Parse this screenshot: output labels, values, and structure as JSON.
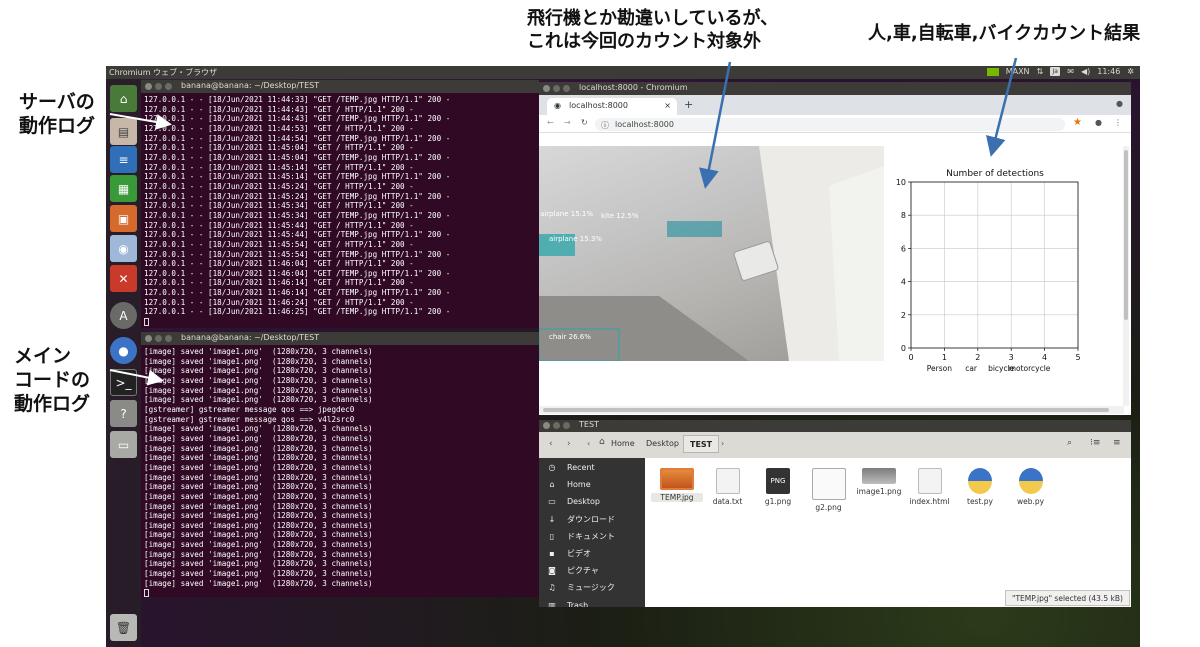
{
  "annotations": {
    "airplane_note_l1": "飛行機とか勘違いしているが、",
    "airplane_note_l2": "これは今回のカウント対象外",
    "count_note": "人,車,自転車,バイクカウント結果",
    "server_note_l1": "サーバの",
    "server_note_l2": "動作ログ",
    "main_note_l1": "メイン",
    "main_note_l2": "コードの",
    "main_note_l3": "動作ログ"
  },
  "topbar": {
    "title": "Chromium ウェブ・ブラウザ",
    "network": "MAXN",
    "keyboard": "Ja",
    "time": "11:46"
  },
  "terminal_top": {
    "title": "banana@banana: ~/Desktop/TEST",
    "lines": [
      "127.0.0.1 - - [18/Jun/2021 11:44:33] \"GET /TEMP.jpg HTTP/1.1\" 200 -",
      "127.0.0.1 - - [18/Jun/2021 11:44:43] \"GET / HTTP/1.1\" 200 -",
      "127.0.0.1 - - [18/Jun/2021 11:44:43] \"GET /TEMP.jpg HTTP/1.1\" 200 -",
      "127.0.0.1 - - [18/Jun/2021 11:44:53] \"GET / HTTP/1.1\" 200 -",
      "127.0.0.1 - - [18/Jun/2021 11:44:54] \"GET /TEMP.jpg HTTP/1.1\" 200 -",
      "127.0.0.1 - - [18/Jun/2021 11:45:04] \"GET / HTTP/1.1\" 200 -",
      "127.0.0.1 - - [18/Jun/2021 11:45:04] \"GET /TEMP.jpg HTTP/1.1\" 200 -",
      "127.0.0.1 - - [18/Jun/2021 11:45:14] \"GET / HTTP/1.1\" 200 -",
      "127.0.0.1 - - [18/Jun/2021 11:45:14] \"GET /TEMP.jpg HTTP/1.1\" 200 -",
      "127.0.0.1 - - [18/Jun/2021 11:45:24] \"GET / HTTP/1.1\" 200 -",
      "127.0.0.1 - - [18/Jun/2021 11:45:24] \"GET /TEMP.jpg HTTP/1.1\" 200 -",
      "127.0.0.1 - - [18/Jun/2021 11:45:34] \"GET / HTTP/1.1\" 200 -",
      "127.0.0.1 - - [18/Jun/2021 11:45:34] \"GET /TEMP.jpg HTTP/1.1\" 200 -",
      "127.0.0.1 - - [18/Jun/2021 11:45:44] \"GET / HTTP/1.1\" 200 -",
      "127.0.0.1 - - [18/Jun/2021 11:45:44] \"GET /TEMP.jpg HTTP/1.1\" 200 -",
      "127.0.0.1 - - [18/Jun/2021 11:45:54] \"GET / HTTP/1.1\" 200 -",
      "127.0.0.1 - - [18/Jun/2021 11:45:54] \"GET /TEMP.jpg HTTP/1.1\" 200 -",
      "127.0.0.1 - - [18/Jun/2021 11:46:04] \"GET / HTTP/1.1\" 200 -",
      "127.0.0.1 - - [18/Jun/2021 11:46:04] \"GET /TEMP.jpg HTTP/1.1\" 200 -",
      "127.0.0.1 - - [18/Jun/2021 11:46:14] \"GET / HTTP/1.1\" 200 -",
      "127.0.0.1 - - [18/Jun/2021 11:46:14] \"GET /TEMP.jpg HTTP/1.1\" 200 -",
      "127.0.0.1 - - [18/Jun/2021 11:46:24] \"GET / HTTP/1.1\" 200 -",
      "127.0.0.1 - - [18/Jun/2021 11:46:25] \"GET /TEMP.jpg HTTP/1.1\" 200 -"
    ]
  },
  "terminal_bottom": {
    "title": "banana@banana: ~/Desktop/TEST",
    "lines": [
      "[image] saved 'image1.png'  (1280x720, 3 channels)",
      "[image] saved 'image1.png'  (1280x720, 3 channels)",
      "[image] saved 'image1.png'  (1280x720, 3 channels)",
      "[image] saved 'image1.png'  (1280x720, 3 channels)",
      "[image] saved 'image1.png'  (1280x720, 3 channels)",
      "[image] saved 'image1.png'  (1280x720, 3 channels)",
      "[gstreamer] gstreamer message qos ==> jpegdec0",
      "[gstreamer] gstreamer message qos ==> v4l2src0",
      "[image] saved 'image1.png'  (1280x720, 3 channels)",
      "[image] saved 'image1.png'  (1280x720, 3 channels)",
      "[image] saved 'image1.png'  (1280x720, 3 channels)",
      "[image] saved 'image1.png'  (1280x720, 3 channels)",
      "[image] saved 'image1.png'  (1280x720, 3 channels)",
      "[image] saved 'image1.png'  (1280x720, 3 channels)",
      "[image] saved 'image1.png'  (1280x720, 3 channels)",
      "[image] saved 'image1.png'  (1280x720, 3 channels)",
      "[image] saved 'image1.png'  (1280x720, 3 channels)",
      "[image] saved 'image1.png'  (1280x720, 3 channels)",
      "[image] saved 'image1.png'  (1280x720, 3 channels)",
      "[image] saved 'image1.png'  (1280x720, 3 channels)",
      "[image] saved 'image1.png'  (1280x720, 3 channels)",
      "[image] saved 'image1.png'  (1280x720, 3 channels)",
      "[image] saved 'image1.png'  (1280x720, 3 channels)",
      "[image] saved 'image1.png'  (1280x720, 3 channels)",
      "[image] saved 'image1.png'  (1280x720, 3 channels)"
    ]
  },
  "browser": {
    "window_title": "localhost:8000 - Chromium",
    "tab_label": "localhost:8000",
    "url": "localhost:8000",
    "detections": [
      {
        "label": "airplane 15.1%"
      },
      {
        "label": "kite 12.5%"
      },
      {
        "label": "airplane 15.3%"
      },
      {
        "label": "chair 26.6%"
      }
    ]
  },
  "chart_data": {
    "type": "bar",
    "title": "Number of detections",
    "categories": [
      "Person",
      "car",
      "bicycle",
      "motorcycle"
    ],
    "values": [
      0,
      0,
      0,
      0
    ],
    "x_ticks": [
      "0",
      "1",
      "2",
      "3",
      "4",
      "5"
    ],
    "y_ticks": [
      "0",
      "2",
      "4",
      "6",
      "8",
      "10"
    ],
    "xlim": [
      0,
      5
    ],
    "ylim": [
      0,
      10
    ],
    "grid": true
  },
  "files": {
    "window_title": "TEST",
    "breadcrumb": [
      "Home",
      "Desktop",
      "TEST"
    ],
    "sidebar": [
      {
        "label": "Recent",
        "icon": "clock-icon"
      },
      {
        "label": "Home",
        "icon": "home-icon"
      },
      {
        "label": "Desktop",
        "icon": "folder-icon"
      },
      {
        "label": "ダウンロード",
        "icon": "download-icon"
      },
      {
        "label": "ドキュメント",
        "icon": "document-icon"
      },
      {
        "label": "ビデオ",
        "icon": "video-icon"
      },
      {
        "label": "ピクチャ",
        "icon": "camera-icon"
      },
      {
        "label": "ミュージック",
        "icon": "music-icon"
      },
      {
        "label": "Trash",
        "icon": "trash-icon"
      }
    ],
    "items": [
      {
        "name": "TEMP.jpg",
        "icon": "image-icon"
      },
      {
        "name": "data.txt",
        "icon": "text-file-icon"
      },
      {
        "name": "g1.png",
        "icon": "png-icon"
      },
      {
        "name": "g2.png",
        "icon": "image-icon"
      },
      {
        "name": "image1.png",
        "icon": "image-icon"
      },
      {
        "name": "index.html",
        "icon": "html-file-icon"
      },
      {
        "name": "test.py",
        "icon": "python-icon"
      },
      {
        "name": "web.py",
        "icon": "python-icon"
      }
    ],
    "status": "\"TEMP.jpg\" selected  (43.5 kB)",
    "png_badge": "PNG"
  }
}
